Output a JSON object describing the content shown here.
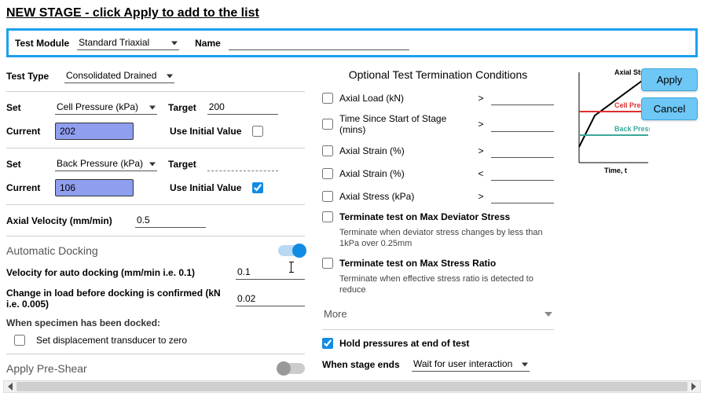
{
  "title": "NEW STAGE - click Apply to add to the list",
  "topbar": {
    "test_module_label": "Test Module",
    "test_module_value": "Standard Triaxial",
    "name_label": "Name",
    "name_value": ""
  },
  "left": {
    "test_type_label": "Test Type",
    "test_type_value": "Consolidated Drained",
    "set1": {
      "set_label": "Set",
      "select_value": "Cell Pressure (kPa)",
      "target_label": "Target",
      "target_value": "200",
      "current_label": "Current",
      "current_value": "202",
      "use_initial_label": "Use Initial Value",
      "use_initial_checked": false
    },
    "set2": {
      "set_label": "Set",
      "select_value": "Back Pressure (kPa)",
      "target_label": "Target",
      "target_value": "",
      "current_label": "Current",
      "current_value": "106",
      "use_initial_label": "Use Initial Value",
      "use_initial_checked": true
    },
    "axial_velocity_label": "Axial Velocity (mm/min)",
    "axial_velocity_value": "0.5",
    "docking": {
      "title": "Automatic Docking",
      "on": true,
      "velocity_label": "Velocity for auto docking (mm/min i.e. 0.1)",
      "velocity_value": "0.1",
      "change_label": "Change in load before docking is confirmed (kN i.e. 0.005)",
      "change_value": "0.02",
      "after_label": "When specimen has been docked:",
      "set_zero_label": "Set displacement transducer to zero",
      "set_zero_checked": false
    },
    "preshear": {
      "label": "Apply Pre-Shear",
      "on": false
    }
  },
  "mid": {
    "title": "Optional Test Termination Conditions",
    "rows": [
      {
        "label": "Axial Load (kN)",
        "op": ">",
        "value": ""
      },
      {
        "label": "Time Since Start of Stage (mins)",
        "op": ">",
        "value": ""
      },
      {
        "label": "Axial Strain (%)",
        "op": ">",
        "value": ""
      },
      {
        "label": "Axial Strain (%)",
        "op": "<",
        "value": ""
      },
      {
        "label": "Axial Stress (kPa)",
        "op": ">",
        "value": ""
      }
    ],
    "max_dev_label": "Terminate test on Max Deviator Stress",
    "max_dev_sub": "Terminate when deviator stress changes by less than 1kPa over 0.25mm",
    "max_ratio_label": "Terminate test on Max Stress Ratio",
    "max_ratio_sub": "Terminate when effective stress ratio is detected to reduce",
    "more_label": "More",
    "hold_label": "Hold pressures at end of test",
    "hold_checked": true,
    "stage_ends_label": "When stage ends",
    "stage_ends_value": "Wait for user interaction"
  },
  "buttons": {
    "apply": "Apply",
    "cancel": "Cancel"
  },
  "chart_data": {
    "type": "line",
    "xlabel": "Time, t",
    "series": [
      {
        "name": "Axial Strain",
        "color": "#000000"
      },
      {
        "name": "Cell Pressure",
        "color": "#e03030"
      },
      {
        "name": "Back Pressure",
        "color": "#3aa89a"
      }
    ]
  }
}
